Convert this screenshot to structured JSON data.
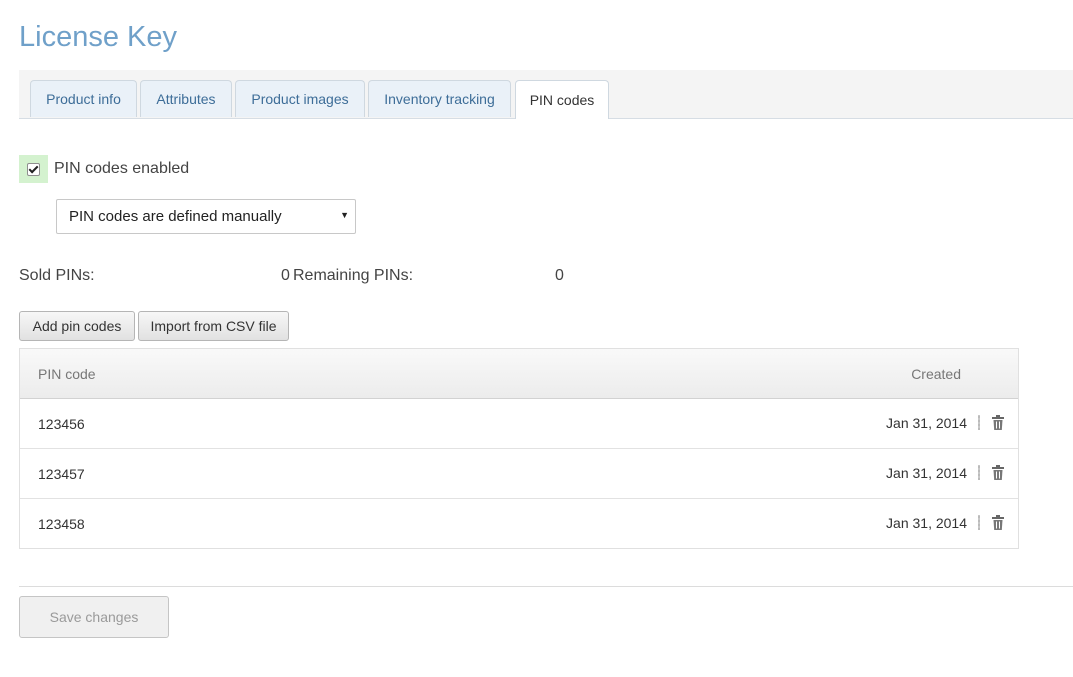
{
  "page": {
    "title": "License Key"
  },
  "tabs": [
    {
      "label": "Product info",
      "active": false
    },
    {
      "label": "Attributes",
      "active": false
    },
    {
      "label": "Product images",
      "active": false
    },
    {
      "label": "Inventory tracking",
      "active": false
    },
    {
      "label": "PIN codes",
      "active": true
    }
  ],
  "pin_settings": {
    "enabled_checked": true,
    "enabled_label": "PIN codes enabled",
    "mode_selected": "PIN codes are defined manually"
  },
  "stats": {
    "sold_label": "Sold PINs:",
    "sold_value": "0",
    "remaining_label": "Remaining PINs:",
    "remaining_value": "0"
  },
  "actions": {
    "add_label": "Add pin codes",
    "import_label": "Import from CSV file"
  },
  "table": {
    "headers": {
      "pin": "PIN code",
      "created": "Created"
    },
    "rows": [
      {
        "pin": "123456",
        "created": "Jan 31, 2014"
      },
      {
        "pin": "123457",
        "created": "Jan 31, 2014"
      },
      {
        "pin": "123458",
        "created": "Jan 31, 2014"
      }
    ]
  },
  "footer": {
    "save_label": "Save changes",
    "save_disabled": true
  },
  "colors": {
    "title": "#6fa0c9",
    "tab_text": "#3d6d98",
    "checkbox_highlight": "#d4f2cf"
  },
  "icons": {
    "checkbox": "checkmark-icon",
    "select_arrow": "caret-down-icon",
    "row_drag": "drag-handle-icon",
    "row_delete": "trash-icon"
  }
}
